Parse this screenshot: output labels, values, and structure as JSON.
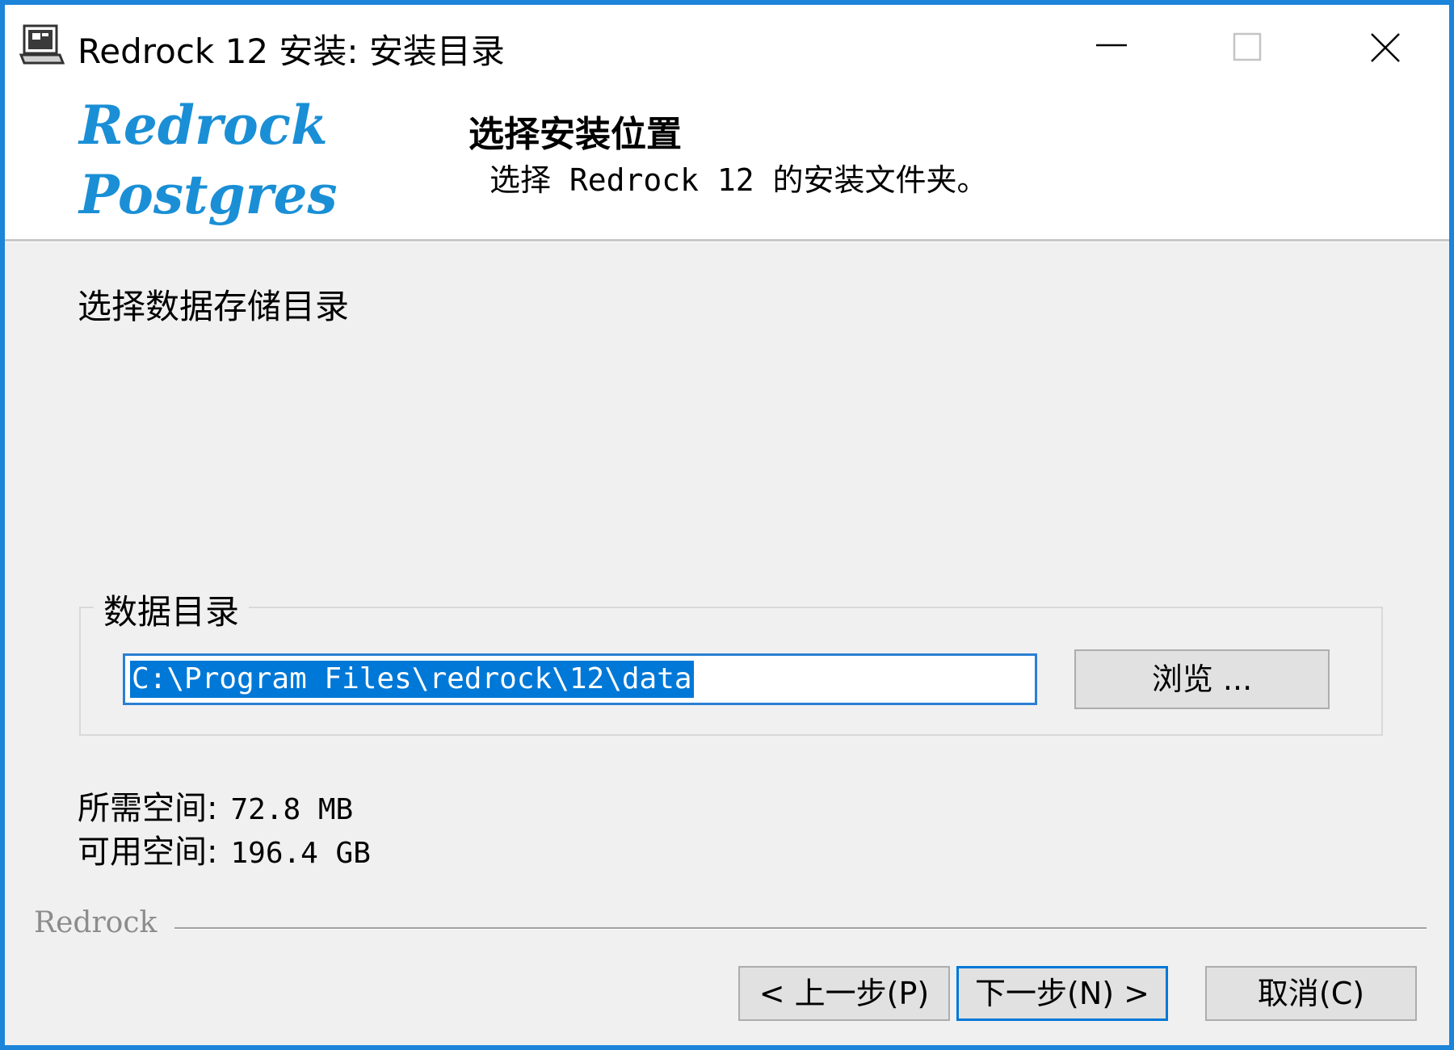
{
  "window": {
    "title": "Redrock 12 安装: 安装目录",
    "controls": {
      "minimize": "minimize-icon",
      "maximize": "maximize-icon",
      "close": "close-icon"
    },
    "border_color": "#1c84d9"
  },
  "header": {
    "logo_line1": "Redrock",
    "logo_line2": "Postgres",
    "logo_color": "#1a8fd6",
    "title": "选择安装位置",
    "subtitle": "选择 Redrock 12 的安装文件夹。"
  },
  "main": {
    "section_label": "选择数据存储目录",
    "group_label": "数据目录",
    "path_value": "C:\\Program Files\\redrock\\12\\data",
    "browse_label": "浏览 ...",
    "required_label": "所需空间:",
    "required_value": "72.8 MB",
    "available_label": "可用空间:",
    "available_value": "196.4 GB"
  },
  "footer": {
    "brand": "Redrock",
    "back_label": "< 上一步(P)",
    "next_label": "下一步(N) >",
    "cancel_label": "取消(C)"
  },
  "colors": {
    "selection": "#0078d7",
    "dialog_bg": "#f0f0f0",
    "focus_border": "#0078d7"
  }
}
